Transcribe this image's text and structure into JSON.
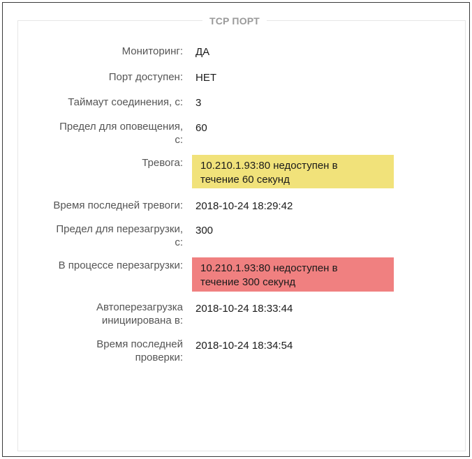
{
  "panel": {
    "title": "TCP ПОРТ"
  },
  "rows": {
    "monitoring": {
      "label": "Мониторинг:",
      "value": "ДА"
    },
    "port_available": {
      "label": "Порт доступен:",
      "value": "НЕТ"
    },
    "connection_timeout": {
      "label": "Таймаут соединения, с:",
      "value": "3"
    },
    "notify_limit": {
      "label_line1": "Предел для оповещения,",
      "label_line2": "с:",
      "value": "60"
    },
    "alarm": {
      "label": "Тревога:",
      "value_line1": "10.210.1.93:80 недоступен в",
      "value_line2": "течение 60 секунд"
    },
    "last_alarm_time": {
      "label": "Время последней тревоги:",
      "value": "2018-10-24 18:29:42"
    },
    "reboot_limit": {
      "label_line1": "Предел для перезагрузки,",
      "label_line2": "с:",
      "value": "300"
    },
    "rebooting": {
      "label": "В процессе перезагрузки:",
      "value_line1": "10.210.1.93:80 недоступен в",
      "value_line2": "течение 300 секунд"
    },
    "autoreboot_initiated": {
      "label_line1": "Автоперезагрузка",
      "label_line2": "инициирована в:",
      "value": "2018-10-24 18:33:44"
    },
    "last_check_time": {
      "label_line1": "Время последней",
      "label_line2": "проверки:",
      "value": "2018-10-24 18:34:54"
    }
  },
  "colors": {
    "alarm_warning": "#f1e27a",
    "alarm_danger": "#f08080"
  }
}
